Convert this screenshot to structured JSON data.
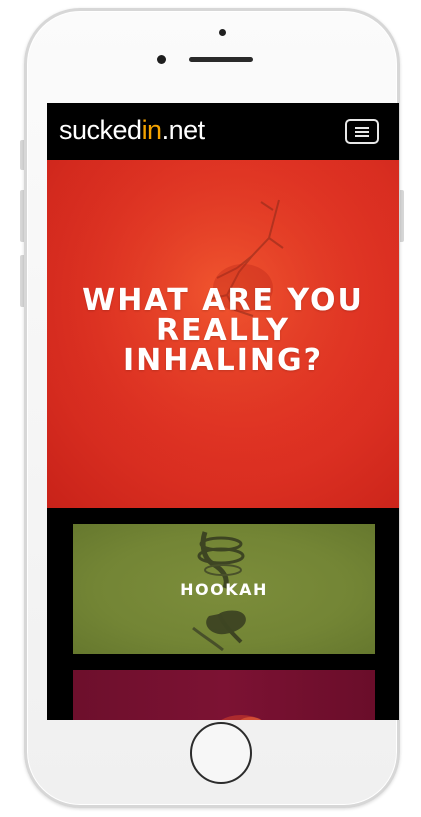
{
  "device": {
    "frame_color": "#f5f5f5",
    "screen_color": "#000000"
  },
  "header": {
    "logo_prefix": "sucked",
    "logo_accent": "in",
    "logo_suffix": ".net",
    "logo_accent_color": "#f5a300",
    "menu_icon": "hamburger-menu-icon"
  },
  "hero": {
    "title_line1": "WHAT ARE YOU",
    "title_line2": "REALLY",
    "title_line3": "INHALING?",
    "background_color": "#e33525"
  },
  "tiles": [
    {
      "label": "HOOKAH",
      "background_color": "#738535"
    },
    {
      "label": "",
      "background_color": "#7c1233"
    }
  ]
}
